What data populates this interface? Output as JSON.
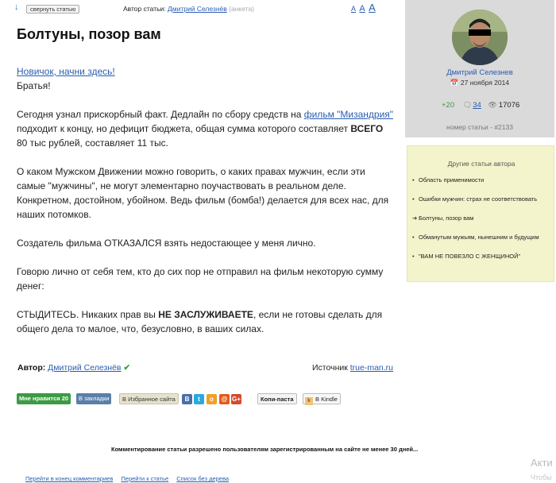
{
  "toolbar": {
    "collapse_label": "свернуть статью",
    "author_prefix": "Автор статьи:",
    "author_name": "Дмитрий Селезнёв",
    "author_profile": "(анкета)",
    "font_sizes": [
      "A",
      "A",
      "A"
    ]
  },
  "article": {
    "title": "Болтуны, позор вам",
    "newcomer_link": "Новичок, начни здесь!",
    "greeting": "Братья!",
    "p1_before": "Сегодня узнал прискорбный факт. Дедлайн по сбору средств на ",
    "p1_link": "фильм \"Мизандрия\"",
    "p1_mid": " под­ходит к концу, но дефицит бюджета, общая сумма которого составляет ",
    "p1_bold": "ВСЕГО",
    "p1_after": " 80 тыс ру­блей, составляет 11 тыс.",
    "p2": "О каком Мужском Движении можно говорить, о каких правах мужчин, если эти самые \"мужчины\", не могут элементарно поучаствовать в реальном деле. Конкретном, достой­ном, убойном. Ведь фильм (бомба!) делается для всех нас, для наших потомков.",
    "p3": "Создатель фильма ОТКАЗАЛСЯ взять недостающее у меня лично.",
    "p4": "Говорю лично от себя тем, кто до сих пор не отправил на фильм некоторую сумму денег:",
    "p5_before": "СТЫДИТЕСЬ. Никаких прав вы ",
    "p5_bold": "НЕ ЗАСЛУЖИВАЕТЕ",
    "p5_after": ", если не готовы сделать для общего дела то малое, что, безусловно, в ваших силах."
  },
  "footer": {
    "author_label": "Автор:",
    "author_name": "Дмитрий Селезнёв",
    "source_label": "Источник",
    "source_link": "true-man.ru"
  },
  "actions": {
    "like": "Мне нравится 20",
    "bookmarks": "В закладки",
    "favorites": "В Избранное сайта",
    "social": [
      "В",
      "t",
      "о",
      "@",
      "G+"
    ],
    "copy_paste": "Копи-паста",
    "kindle": "В Kindle"
  },
  "comment_note": "Комментирование статьи разрешено пользователям зарегистрированным на сайте не менее 30 дней...",
  "bottom_links": [
    "Перейти в конец комментариев",
    "Перейти к статье",
    "Список без дерева"
  ],
  "watermark": [
    "Акти",
    "Чтобы"
  ],
  "sidebar": {
    "author_name": "Дмитрий Селезнев",
    "date": "27 ноября 2014",
    "rating": "+20",
    "comments": "34",
    "views": "17076",
    "article_number": "номер статьи - #2133",
    "other_articles_title": "Другие статьи автора",
    "other_articles": [
      {
        "bullet": "•",
        "label": "Область применимости"
      },
      {
        "bullet": "•",
        "label": "Ошибки мужчин: страх не соответствовать"
      },
      {
        "bullet": "➔",
        "label": "Болтуны, позор вам"
      },
      {
        "bullet": "•",
        "label": "Обманутым мужьям, нынешним и будущим"
      },
      {
        "bullet": "•",
        "label": "\"ВАМ НЕ ПОВЕЗЛО С ЖЕНЩИНОЙ\""
      }
    ]
  },
  "colors": {
    "link": "#2a5db0",
    "like_button": "#3c9b43",
    "sidebar_grey": "#dadada",
    "sidebar_yellow": "#f4f4cc"
  }
}
